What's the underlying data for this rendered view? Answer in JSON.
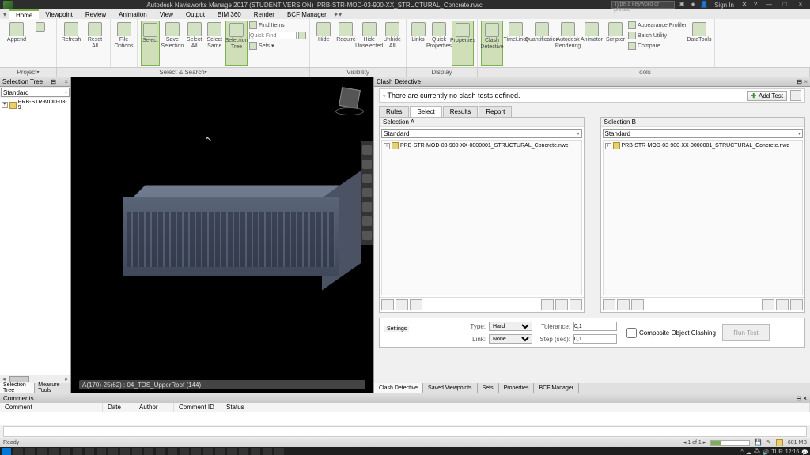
{
  "titlebar": {
    "app": "Autodesk Navisworks Manage 2017 (STUDENT VERSION)",
    "file": "PRB-STR-MOD-03-900-XX_STRUCTURAL_Concrete.nwc",
    "search_ph": "Type a keyword or phrase",
    "signin": "Sign In",
    "help_icon": "?",
    "min": "—",
    "max": "□",
    "close": "×"
  },
  "menubar": {
    "tabs": [
      "Home",
      "Viewpoint",
      "Review",
      "Animation",
      "View",
      "Output",
      "BIM 360",
      "Render",
      "BCF Manager"
    ],
    "active": 0
  },
  "ribbon": {
    "append": "Append",
    "refresh": "Refresh",
    "reset_all": "Reset\nAll",
    "file_options": "File\nOptions",
    "select": "Select",
    "save_sel": "Save\nSelection",
    "select_all": "Select\nAll",
    "select_same": "Select\nSame",
    "selection_tree": "Selection\nTree",
    "find_items": "Find Items",
    "quick_find_ph": "Quick Find",
    "sets": "Sets",
    "hide": "Hide",
    "require": "Require",
    "hide_unsel": "Hide\nUnselected",
    "unhide_all": "Unhide\nAll",
    "links": "Links",
    "quick_props": "Quick\nProperties",
    "properties": "Properties",
    "clash": "Clash\nDetective",
    "timeliner": "TimeLiner",
    "quant": "Quantification",
    "rendering": "Autodesk\nRendering",
    "animator": "Animator",
    "scripter": "Scripter",
    "app_profiler": "Appearance Profiler",
    "batch_util": "Batch Utility",
    "compare": "Compare",
    "datatools": "DataTools"
  },
  "groupbar": {
    "project": "Project",
    "select_search": "Select & Search",
    "visibility": "Visibility",
    "display": "Display",
    "tools": "Tools"
  },
  "lefttree": {
    "title": "Selection Tree",
    "mode": "Standard",
    "root": "PRB-STR-MOD-03-9",
    "tab1": "Selection Tree",
    "tab2": "Measure Tools"
  },
  "viewport": {
    "status": "A(170)-25(62) : 04_TOS_UpperRoof (144)"
  },
  "clash": {
    "title": "Clash Detective",
    "msg": "There are currently no clash tests defined.",
    "addtest": "Add Test",
    "tabs": [
      "Rules",
      "Select",
      "Results",
      "Report"
    ],
    "active_tab": 1,
    "selA": "Selection A",
    "selB": "Selection B",
    "sel_mode": "Standard",
    "sel_item": "PRB-STR-MOD-03-900-XX-0000001_STRUCTURAL_Concrete.nwc",
    "settings": {
      "hdr": "Settings",
      "type_l": "Type:",
      "type_v": "Hard",
      "link_l": "Link:",
      "link_v": "None",
      "tol_l": "Tolerance:",
      "tol_v": "0,1",
      "step_l": "Step (sec):",
      "step_v": "0,1",
      "composite": "Composite Object Clashing",
      "run": "Run Test"
    },
    "btabs": [
      "Clash Detective",
      "Saved Viewpoints",
      "Sets",
      "Properties",
      "BCF Manager"
    ]
  },
  "comments": {
    "title": "Comments",
    "cols": [
      "Comment",
      "Date",
      "Author",
      "Comment ID",
      "Status"
    ]
  },
  "status": {
    "ready": "Ready",
    "page": "1 of 1",
    "mem": "601 MB"
  },
  "taskbar": {
    "time": "TUR",
    "date": "12:16"
  }
}
